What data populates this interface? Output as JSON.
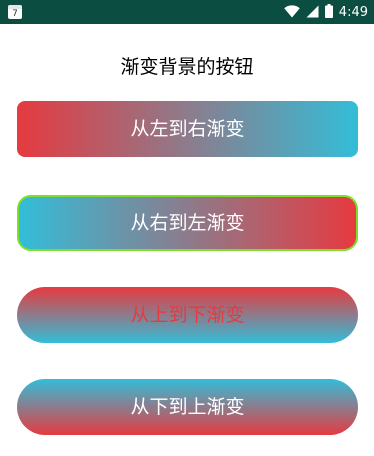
{
  "status_bar": {
    "calendar_day": "7",
    "time": "4:49",
    "icons": [
      "calendar-icon",
      "wifi-icon",
      "cell-signal-icon",
      "battery-icon"
    ]
  },
  "title": "渐变背景的按钮",
  "buttons": [
    {
      "label": "从左到右渐变",
      "gradient": [
        "#e63a40",
        "#33bdd8"
      ],
      "direction": "left-to-right"
    },
    {
      "label": "从右到左渐变",
      "gradient": [
        "#33bdd8",
        "#e63a40"
      ],
      "direction": "right-to-left",
      "border_color": "#7ddf2c"
    },
    {
      "label": "从上到下渐变",
      "gradient": [
        "#e63a40",
        "#33bdd8"
      ],
      "direction": "top-to-bottom",
      "text_color": "#e63a40"
    },
    {
      "label": "从下到上渐变",
      "gradient": [
        "#33bdd8",
        "#e63a40"
      ],
      "direction": "bottom-to-top"
    }
  ],
  "colors": {
    "status_bar_bg": "#0b4d40",
    "red": "#e63a40",
    "cyan": "#33bdd8",
    "green_border": "#7ddf2c"
  }
}
